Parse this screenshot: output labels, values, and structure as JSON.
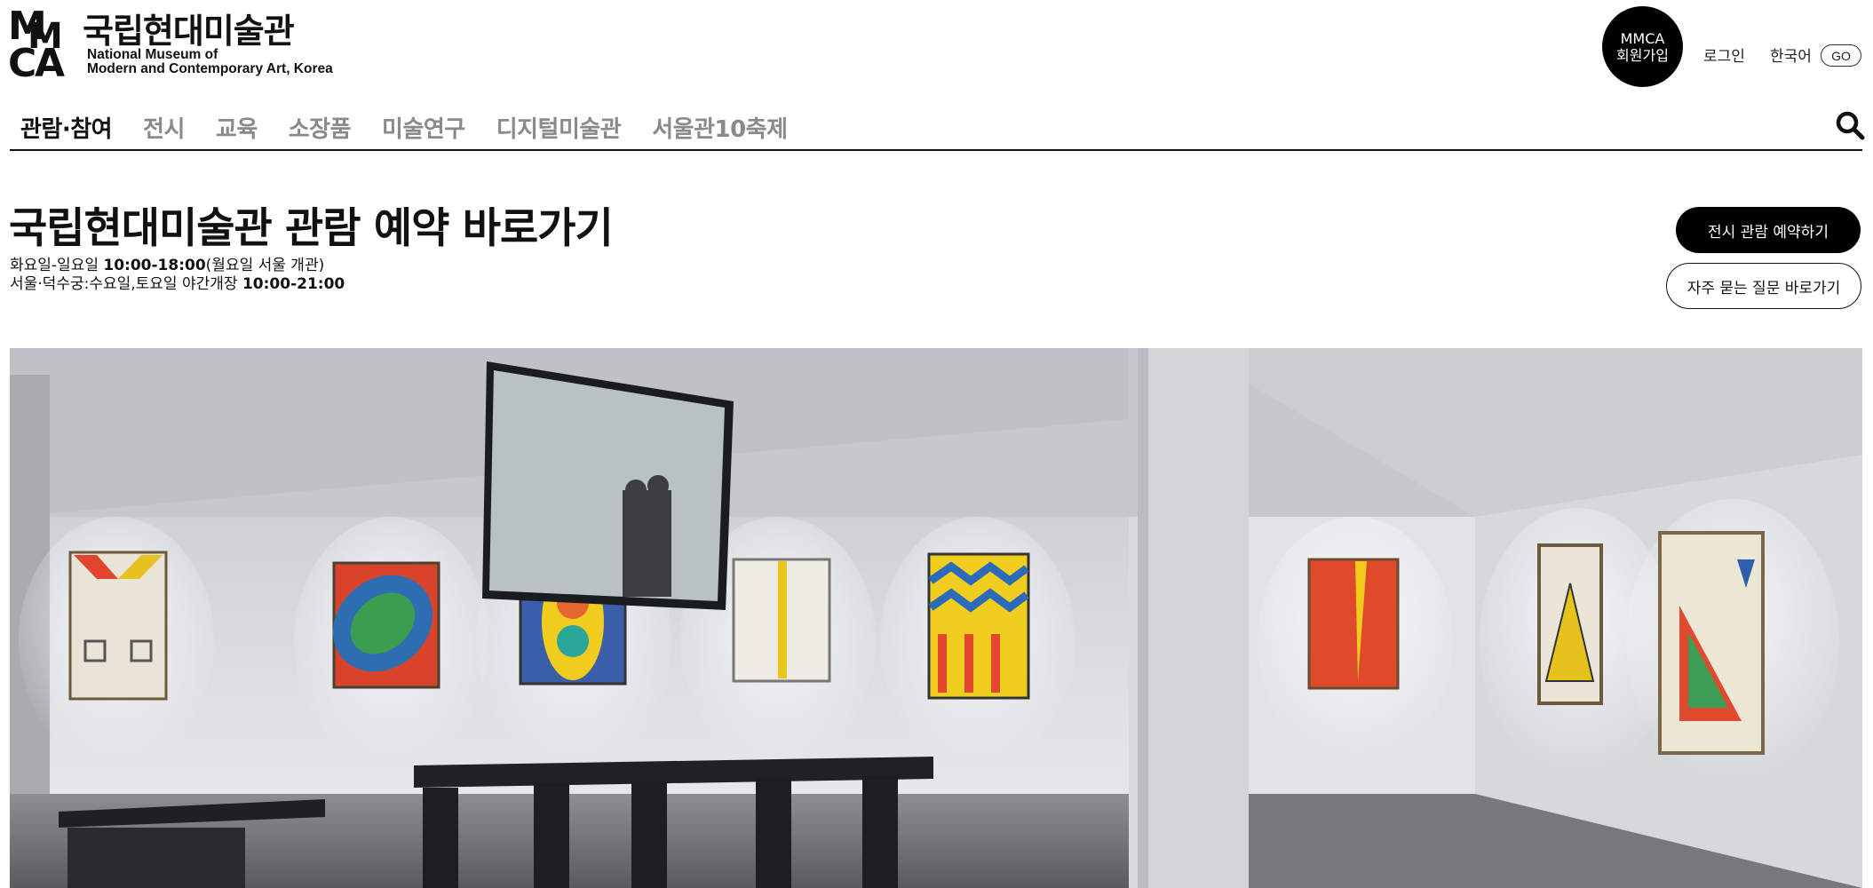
{
  "header": {
    "logo_mark": "MMCA",
    "logo_name_ko": "국립현대미술관",
    "logo_name_en_line1": "National Museum of",
    "logo_name_en_line2": "Modern and Contemporary Art, Korea",
    "member_line1": "MMCA",
    "member_line2": "회원가입",
    "login_label": "로그인",
    "language_label": "한국어",
    "language_go": "GO",
    "search_icon": "search-icon"
  },
  "nav": {
    "items": [
      {
        "label": "관람·참여",
        "active": true
      },
      {
        "label": "전시",
        "active": false
      },
      {
        "label": "교육",
        "active": false
      },
      {
        "label": "소장품",
        "active": false
      },
      {
        "label": "미술연구",
        "active": false
      },
      {
        "label": "디지털미술관",
        "active": false
      },
      {
        "label": "서울관10축제",
        "active": false
      }
    ]
  },
  "reservation": {
    "title": "국립현대미술관 관람 예약 바로가기",
    "hours_line1_prefix": "화요일-일요일 ",
    "hours_line1_time": "10:00-18:00",
    "hours_line1_suffix": "(월요일 서울 개관)",
    "hours_line2_prefix": "서울·덕수궁:수요일,토요일 야간개장 ",
    "hours_line2_time": "10:00-21:00",
    "reserve_button": "전시 관람 예약하기",
    "faq_button": "자주 묻는 질문 바로가기"
  },
  "hero": {
    "image_subject": "gallery-interior-photo"
  },
  "colors": {
    "text": "#111111",
    "nav_inactive": "#8a8a8a",
    "button_dark": "#000000",
    "background": "#ffffff"
  }
}
